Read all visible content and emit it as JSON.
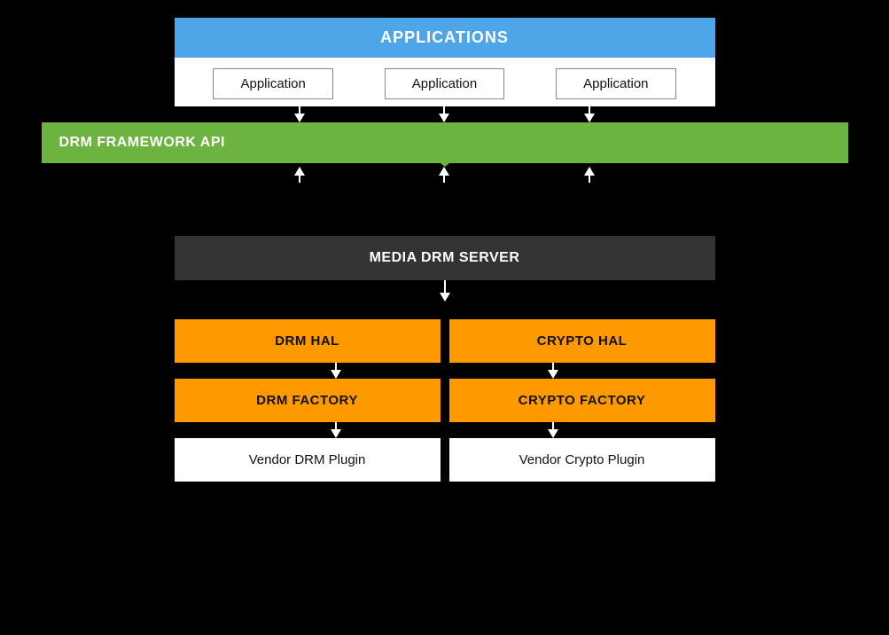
{
  "applications": {
    "header": "APPLICATIONS",
    "app1": "Application",
    "app2": "Application",
    "app3": "Application"
  },
  "drm_framework": {
    "label": "DRM FRAMEWORK API"
  },
  "media_drm": {
    "label": "MEDIA DRM SERVER"
  },
  "hal": {
    "drm": "DRM HAL",
    "crypto": "CRYPTO HAL"
  },
  "factory": {
    "drm": "DRM FACTORY",
    "crypto": "CRYPTO FACTORY"
  },
  "vendor": {
    "drm": "Vendor DRM Plugin",
    "crypto": "Vendor Crypto Plugin"
  },
  "colors": {
    "blue": "#4da6e8",
    "green": "#6db33f",
    "dark": "#333333",
    "orange": "#ff9900",
    "white": "#ffffff",
    "black": "#000000"
  }
}
